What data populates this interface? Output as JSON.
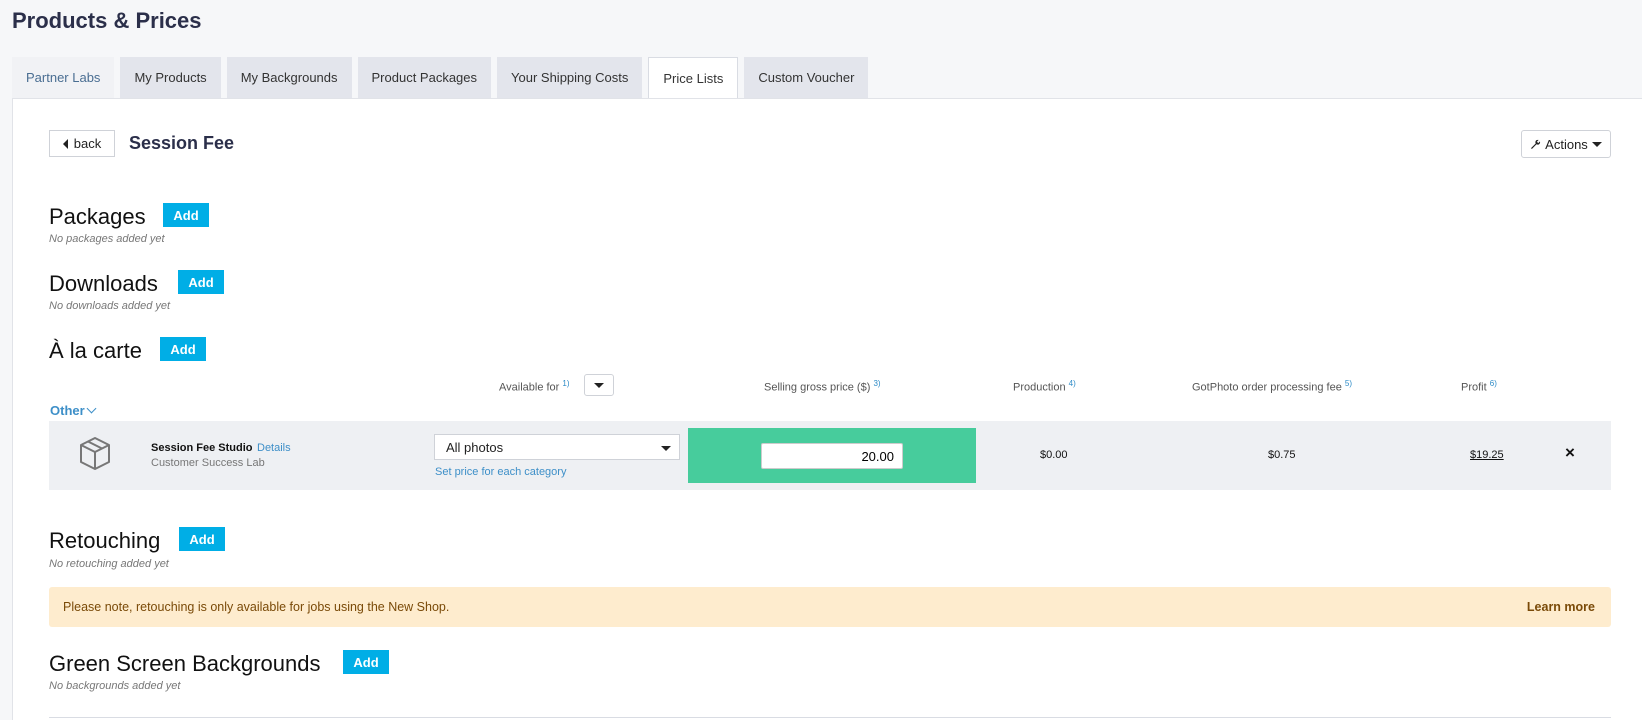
{
  "page_title": "Products & Prices",
  "tabs": [
    {
      "label": "Partner Labs"
    },
    {
      "label": "My Products"
    },
    {
      "label": "My Backgrounds"
    },
    {
      "label": "Product Packages"
    },
    {
      "label": "Your Shipping Costs"
    },
    {
      "label": "Price Lists",
      "active": true
    },
    {
      "label": "Custom Voucher"
    }
  ],
  "header": {
    "back_label": "back",
    "title": "Session Fee",
    "actions_label": "Actions"
  },
  "sections": {
    "packages": {
      "title": "Packages",
      "add": "Add",
      "empty": "No packages added yet"
    },
    "downloads": {
      "title": "Downloads",
      "add": "Add",
      "empty": "No downloads added yet"
    },
    "alacarte": {
      "title": "À la carte",
      "add": "Add"
    },
    "retouching": {
      "title": "Retouching",
      "add": "Add",
      "empty": "No retouching added yet"
    },
    "greenscreen": {
      "title": "Green Screen Backgrounds",
      "add": "Add",
      "empty": "No backgrounds added yet"
    }
  },
  "columns": {
    "available_for": "Available for",
    "available_for_note": "1)",
    "selling_price": "Selling gross price ($)",
    "selling_price_note": "3)",
    "production": "Production",
    "production_note": "4)",
    "fee": "GotPhoto order processing fee",
    "fee_note": "5)",
    "profit": "Profit",
    "profit_note": "6)"
  },
  "category": "Other",
  "product_row": {
    "name": "Session Fee Studio",
    "details_link": "Details",
    "lab": "Customer Success Lab",
    "available_for": "All photos",
    "set_price_link": "Set price for each category",
    "selling_price": "20.00",
    "production": "$0.00",
    "fee": "$0.75",
    "profit": "$19.25",
    "remove": "×"
  },
  "notice": {
    "text": "Please note, retouching is only available for jobs using the New Shop.",
    "link": "Learn more"
  },
  "colors": {
    "accent": "#00aee6",
    "price_cell": "#47cc9c",
    "notice_bg": "#feecce",
    "link": "#3d8fc8"
  }
}
